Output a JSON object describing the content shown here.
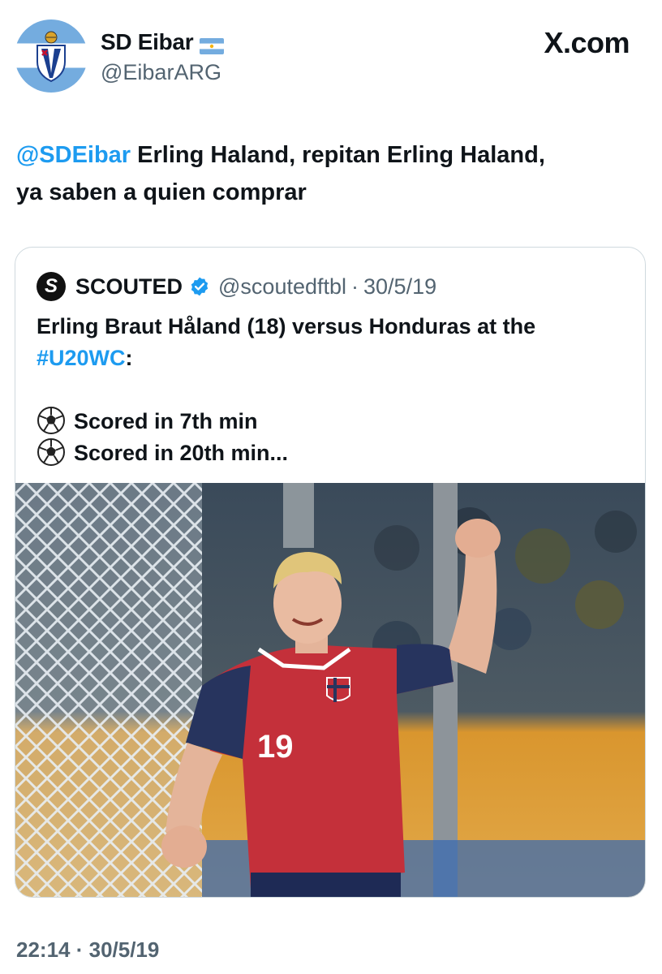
{
  "author": {
    "name": "SD Eibar",
    "handle": "@EibarARG",
    "avatar": "sd-eibar-crest-argentina-flag"
  },
  "brand": "X.com",
  "tweet": {
    "mention": "@SDEibar",
    "line1": " Erling Haland, repitan Erling Haland,",
    "line2": "ya saben a quien comprar"
  },
  "quote": {
    "name": "SCOUTED",
    "logo_letter": "S",
    "handle": "@scoutedftbl",
    "separator": "·",
    "date": "30/5/19",
    "text_line1": "Erling Braut Håland (18) versus Honduras at the",
    "hashtag": "#U20WC",
    "hashtag_suffix": ":",
    "bullets": [
      "Scored in 7th min",
      "Scored in 20th min..."
    ],
    "image": {
      "description_icon": "soccer-player-celebrating-photo",
      "shirt_number": "19"
    }
  },
  "footer": {
    "timestamp": "22:14 · 30/5/19"
  },
  "colors": {
    "link": "#1d9bf0",
    "muted": "#536471",
    "text": "#0f1419",
    "border": "#cfd9de",
    "norway_red": "#c4303a",
    "norway_navy": "#27345e"
  }
}
